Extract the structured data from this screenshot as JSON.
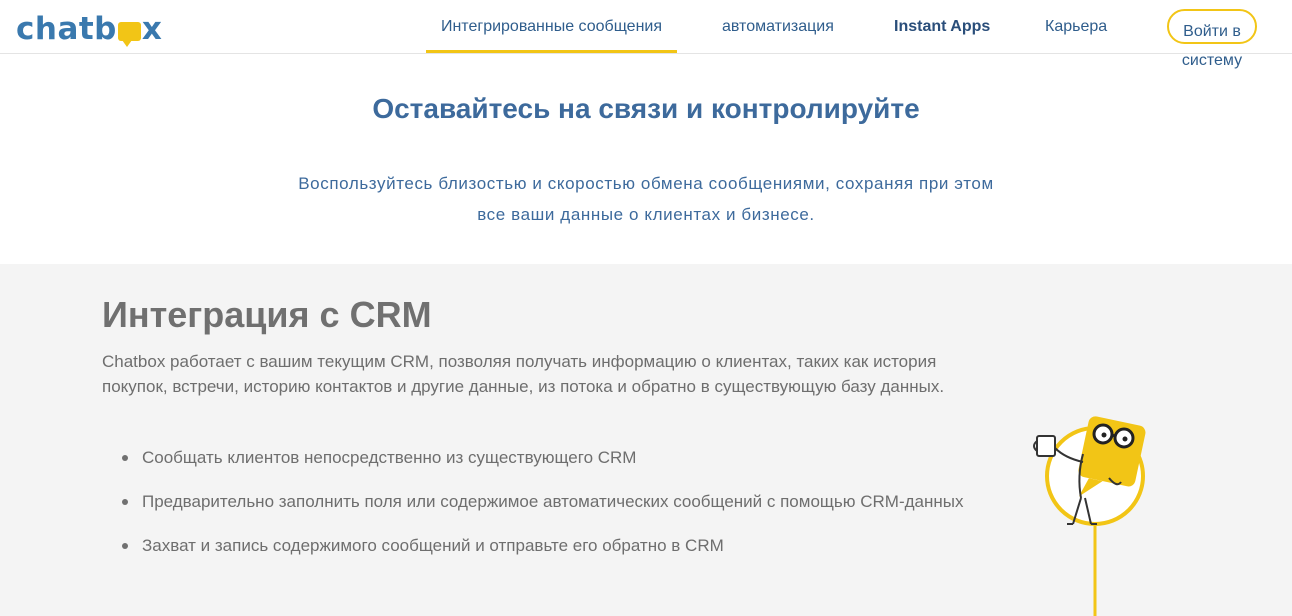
{
  "header": {
    "logo": {
      "text_before": "chatb",
      "text_after": "x"
    },
    "nav": [
      {
        "label": "Интегрированные сообщения",
        "active": true
      },
      {
        "label": "автоматизация",
        "active": false
      },
      {
        "label": "Instant Apps",
        "active": false
      },
      {
        "label": "Карьера",
        "active": false
      }
    ],
    "login": {
      "line1": "Войти в",
      "line2": "систему"
    }
  },
  "hero": {
    "title": "Оставайтесь на связи и контролируйте",
    "subtitle_line1": "Воспользуйтесь близостью и скоростью обмена сообщениями, сохраняя при этом",
    "subtitle_line2": "все ваши данные о клиентах и бизнесе."
  },
  "crm": {
    "title": "Интеграция с CRM",
    "description": "Chatbox работает с вашим текущим CRM, позволяя получать информацию о клиентах, таких как история покупок, встречи, историю контактов и другие данные, из потока и обратно в существующую базу данных.",
    "items": [
      "Сообщать клиентов непосредственно из существующего CRM",
      "Предварительно заполнить поля или содержимое автоматических сообщений с помощью CRM-данных",
      "Захват и запись содержимого сообщений и отправьте его обратно в CRM"
    ]
  },
  "colors": {
    "accent": "#f2c516",
    "brand_blue": "#3a79ae",
    "section_bg": "#f4f4f4"
  },
  "icons": {
    "logo_bubble": "speech-bubble-icon",
    "illustration": "coffee-mascot-illustration"
  }
}
